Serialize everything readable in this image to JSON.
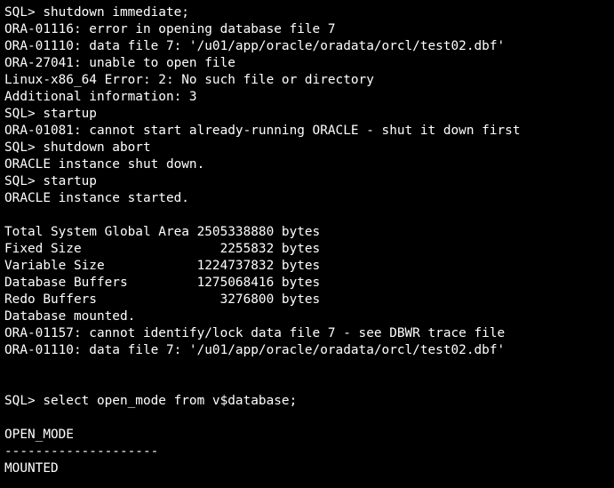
{
  "terminal": {
    "lines": [
      "SQL> shutdown immediate;",
      "ORA-01116: error in opening database file 7",
      "ORA-01110: data file 7: '/u01/app/oracle/oradata/orcl/test02.dbf'",
      "ORA-27041: unable to open file",
      "Linux-x86_64 Error: 2: No such file or directory",
      "Additional information: 3",
      "SQL> startup",
      "ORA-01081: cannot start already-running ORACLE - shut it down first",
      "SQL> shutdown abort",
      "ORACLE instance shut down.",
      "SQL> startup",
      "ORACLE instance started.",
      "",
      "Total System Global Area 2505338880 bytes",
      "Fixed Size                  2255832 bytes",
      "Variable Size            1224737832 bytes",
      "Database Buffers         1275068416 bytes",
      "Redo Buffers                3276800 bytes",
      "Database mounted.",
      "ORA-01157: cannot identify/lock data file 7 - see DBWR trace file",
      "ORA-01110: data file 7: '/u01/app/oracle/oradata/orcl/test02.dbf'",
      "",
      "",
      "SQL> select open_mode from v$database;",
      "",
      "OPEN_MODE",
      "--------------------",
      "MOUNTED"
    ]
  }
}
